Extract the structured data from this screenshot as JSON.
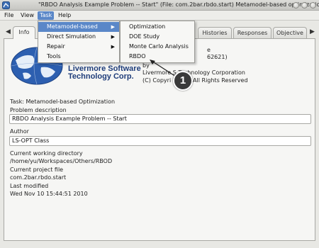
{
  "window": {
    "title": "\"RBDO Analysis Example Problem -- Start\" (File: com.2bar.rbdo.start)   Metamodel-based optimization"
  },
  "menubar": {
    "items": [
      "File",
      "View",
      "Task",
      "Help"
    ]
  },
  "task_menu": {
    "items": [
      {
        "label": "Metamodel-based",
        "has_submenu": true
      },
      {
        "label": "Direct Simulation",
        "has_submenu": true
      },
      {
        "label": "Repair",
        "has_submenu": true
      },
      {
        "label": "Tools",
        "has_submenu": false
      }
    ]
  },
  "submenu": {
    "items": [
      "Optimization",
      "DOE Study",
      "Monte Carlo Analysis",
      "RBDO"
    ]
  },
  "tabs": {
    "items": [
      "Info",
      "Histories",
      "Responses",
      "Objective"
    ]
  },
  "info": {
    "logo_text_line1": "Livermore Software",
    "logo_text_line2": "Technology Corp.",
    "version_line": "e",
    "zip_line": "62621)",
    "by_line": "by",
    "company_line": "Livermore S   Technology Corporation",
    "copyright_line": "(C) Copyri   2010 - All Rights Reserved"
  },
  "fields": {
    "task_label": "Task: Metamodel-based Optimization",
    "problem_description_label": "Problem description",
    "problem_description_value": "RBDO Analysis Example Problem -- Start",
    "author_label": "Author",
    "author_value": "LS-OPT Class",
    "cwd_label": "Current working directory",
    "cwd_value": "/home/yu/Workspaces/Others/RBOD",
    "project_file_label": "Current project file",
    "project_file_value": "com.2bar.rbdo.start",
    "last_modified_label": "Last modified",
    "last_modified_value": "Wed Nov 10 15:44:51 2010"
  },
  "callout": {
    "number": "1"
  },
  "colors": {
    "highlight": "#5a87c8",
    "logo_blue": "#1f3d7a"
  }
}
